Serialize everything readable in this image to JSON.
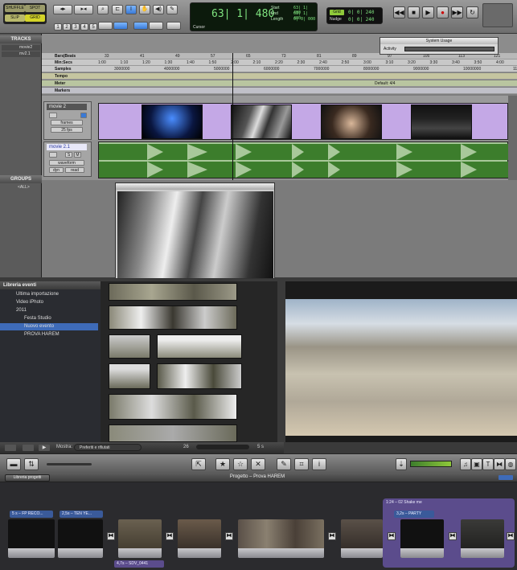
{
  "protools": {
    "modes": {
      "shuffle": "SHUFFLE",
      "spot": "SPOT",
      "slip": "SLIP",
      "grid": "GRID"
    },
    "counter": {
      "main": "63| 1| 480",
      "start_label": "Start",
      "end_label": "End",
      "length_label": "Length",
      "start_val": "63| 1| 480",
      "end_val": "63| 1| 480",
      "length_val": "0| 0| 000",
      "cursor_label": "Cursor"
    },
    "nudge": {
      "grid_label": "Grid",
      "grid_val": "0| 0| 240",
      "nudge_label": "Nudge",
      "nudge_val": "0| 0| 240"
    },
    "num_buttons": [
      "1",
      "2",
      "3",
      "4",
      "5"
    ],
    "sidebar": {
      "tracks_header": "TRACKS",
      "groups_header": "GROUPS",
      "tracks": [
        "movie2",
        "mv2.1"
      ],
      "group_item": "<ALL>"
    },
    "rulers": {
      "bars_label": "Bars|Beats",
      "minsecs_label": "Min:Secs",
      "samples_label": "Samples",
      "tempo_label": "Tempo",
      "meter_label": "Meter",
      "markers_label": "Markers",
      "meter_value": "Default: 4/4",
      "bars": [
        "33",
        "41",
        "49",
        "57",
        "65",
        "73",
        "81",
        "89",
        "97",
        "105",
        "113",
        "121"
      ],
      "minsecs": [
        "1:00",
        "1:10",
        "1:20",
        "1:30",
        "1:40",
        "1:50",
        "2:00",
        "2:10",
        "2:20",
        "2:30",
        "2:40",
        "2:50",
        "3:00",
        "3:10",
        "3:20",
        "3:30",
        "3:40",
        "3:50",
        "4:00"
      ],
      "samples": [
        "3000000",
        "4000000",
        "5000000",
        "6000000",
        "7000000",
        "8000000",
        "9000000",
        "10000000",
        "11000000"
      ]
    },
    "track1": {
      "name": "movie 2",
      "view": "frames",
      "fps": "25 fps"
    },
    "track2": {
      "name": "movie 2.1",
      "view": "waveform",
      "dyn": "dyn",
      "mode": "read"
    },
    "system_usage": {
      "title": "System Usage",
      "activity": "Activity"
    }
  },
  "imovie": {
    "library_header": "Libreria eventi",
    "library_items": [
      "Ultima importazione",
      "Video iPhoto",
      "2011",
      "Festa Studio",
      "Nuovo evento",
      "PROVA HAREM"
    ],
    "show_label": "Mostra:",
    "show_value": "Preferiti e rifiutati",
    "zoom_value": "26",
    "duration_value": "5 s",
    "project_library_btn": "Libreria progetti",
    "project_title": "Progetto – Prova HAREM",
    "titles": [
      "5 s – FP RECO...",
      "2,5s – TEN YE...",
      "4,7s – SDV_0441",
      "1:24 – 02 Shake me",
      "3,2s – PARTY"
    ],
    "colors": {
      "audio_purple": "#5b4c8c",
      "selection_blue": "#3a5a9a",
      "wave_green": "#3c7d2c",
      "clip_lilac": "#c4a8e6"
    }
  }
}
